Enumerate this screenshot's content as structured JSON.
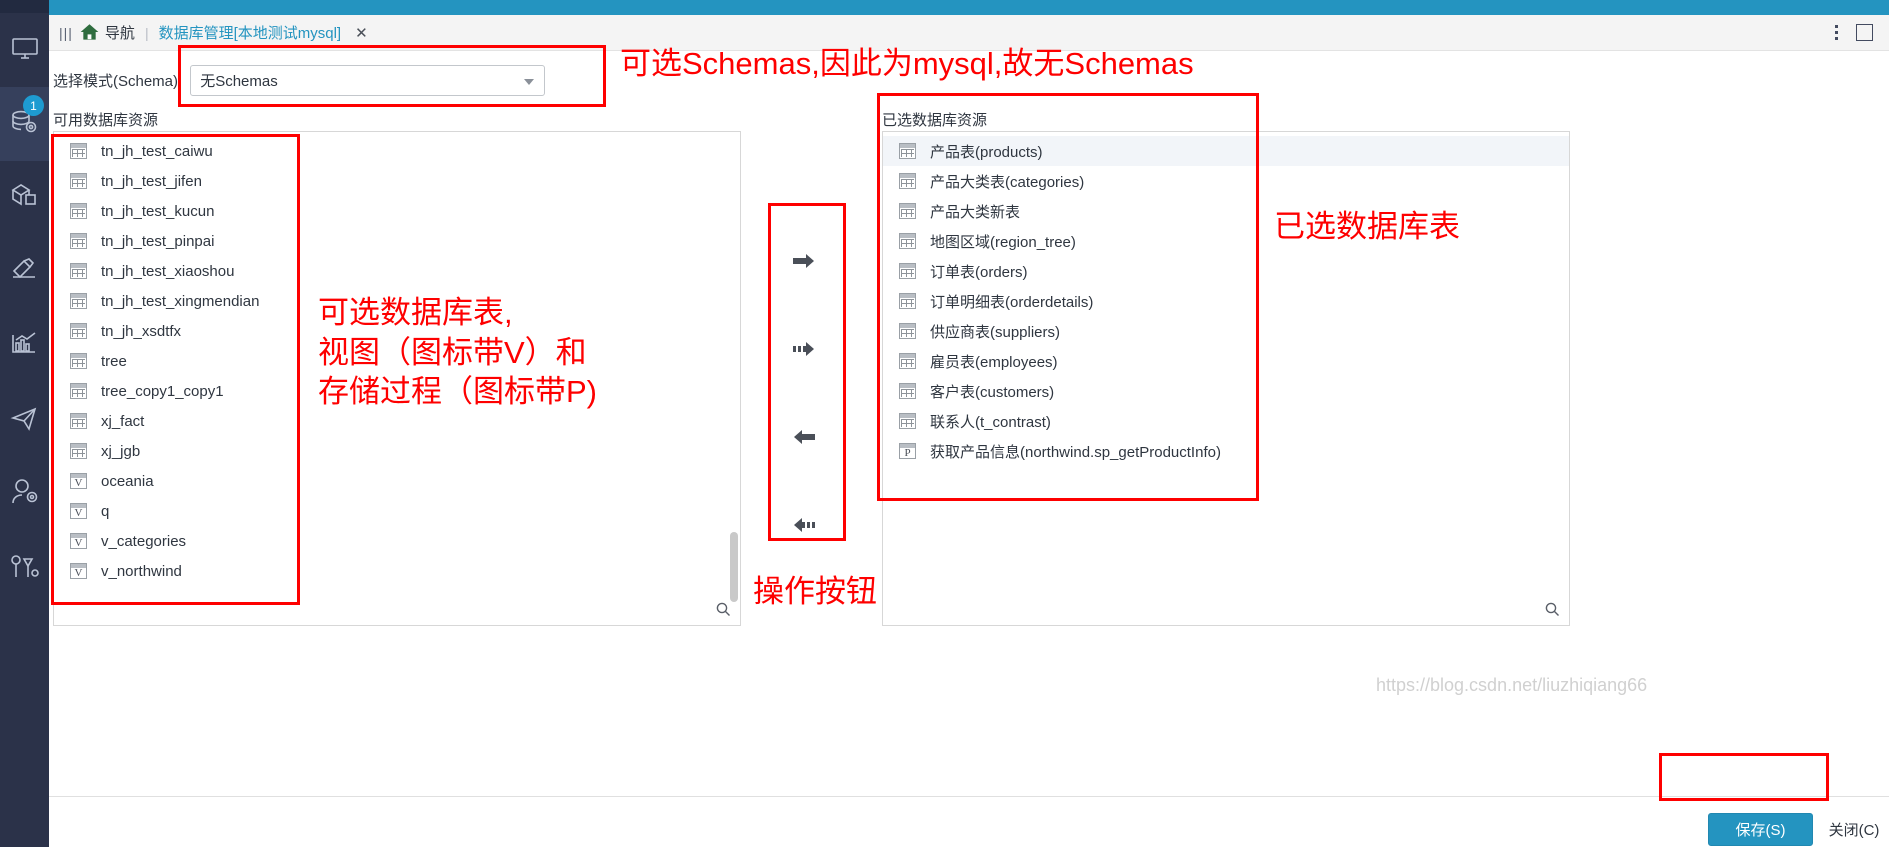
{
  "window": {
    "topbar_color": "#2494c0",
    "accent_color": "#2494c0",
    "annotation_color": "#fe0000"
  },
  "tabstrip": {
    "grip_icon": "grip-icon",
    "home_icon": "home-icon",
    "nav_label": "导航",
    "separator": "|",
    "tab_title": "数据库管理[本地测试mysql]",
    "tab_close": "✕",
    "kebab_icon": "more-options-icon",
    "maximize_icon": "maximize-icon"
  },
  "sidebar": {
    "items": [
      {
        "icon": "monitor-icon",
        "active": false,
        "badge": null
      },
      {
        "icon": "database-settings-icon",
        "active": true,
        "badge": "1"
      },
      {
        "icon": "package-icon",
        "active": false,
        "badge": null
      },
      {
        "icon": "hammer-icon",
        "active": false,
        "badge": null
      },
      {
        "icon": "bar-chart-icon",
        "active": false,
        "badge": null
      },
      {
        "icon": "send-icon",
        "active": false,
        "badge": null
      },
      {
        "icon": "user-settings-icon",
        "active": false,
        "badge": null
      },
      {
        "icon": "tools-icon",
        "active": false,
        "badge": null
      }
    ]
  },
  "schema": {
    "label": "选择模式(Schema):",
    "value": "无Schemas",
    "dropdown_icon": "chevron-down-icon"
  },
  "available": {
    "title": "可用数据库资源",
    "search_icon": "search-icon",
    "items": [
      {
        "name": "tn_jh_test_caiwu",
        "kind": "table"
      },
      {
        "name": "tn_jh_test_jifen",
        "kind": "table"
      },
      {
        "name": "tn_jh_test_kucun",
        "kind": "table"
      },
      {
        "name": "tn_jh_test_pinpai",
        "kind": "table"
      },
      {
        "name": "tn_jh_test_xiaoshou",
        "kind": "table"
      },
      {
        "name": "tn_jh_test_xingmendian",
        "kind": "table"
      },
      {
        "name": "tn_jh_xsdtfx",
        "kind": "table"
      },
      {
        "name": "tree",
        "kind": "table"
      },
      {
        "name": "tree_copy1_copy1",
        "kind": "table"
      },
      {
        "name": "xj_fact",
        "kind": "table"
      },
      {
        "name": "xj_jgb",
        "kind": "table"
      },
      {
        "name": "oceania",
        "kind": "view"
      },
      {
        "name": "q",
        "kind": "view"
      },
      {
        "name": "v_categories",
        "kind": "view"
      },
      {
        "name": "v_northwind",
        "kind": "view"
      }
    ]
  },
  "selected": {
    "title": "已选数据库资源",
    "search_icon": "search-icon",
    "items": [
      {
        "name": "产品表(products)",
        "kind": "table",
        "selected": true
      },
      {
        "name": "产品大类表(categories)",
        "kind": "table",
        "selected": false
      },
      {
        "name": "产品大类新表",
        "kind": "table",
        "selected": false
      },
      {
        "name": "地图区域(region_tree)",
        "kind": "table",
        "selected": false
      },
      {
        "name": "订单表(orders)",
        "kind": "table",
        "selected": false
      },
      {
        "name": "订单明细表(orderdetails)",
        "kind": "table",
        "selected": false
      },
      {
        "name": "供应商表(suppliers)",
        "kind": "table",
        "selected": false
      },
      {
        "name": "雇员表(employees)",
        "kind": "table",
        "selected": false
      },
      {
        "name": "客户表(customers)",
        "kind": "table",
        "selected": false
      },
      {
        "name": "联系人(t_contrast)",
        "kind": "table",
        "selected": false
      },
      {
        "name": "获取产品信息(northwind.sp_getProductInfo)",
        "kind": "procedure",
        "selected": false
      }
    ]
  },
  "transfer": {
    "buttons": [
      {
        "icon": "arrow-right-icon",
        "name": "move-right-button"
      },
      {
        "icon": "arrow-right-all-icon",
        "name": "move-all-right-button"
      },
      {
        "icon": "arrow-left-icon",
        "name": "move-left-button"
      },
      {
        "icon": "arrow-left-all-icon",
        "name": "move-all-left-button"
      }
    ]
  },
  "footer": {
    "save_label": "保存(S)",
    "close_label": "关闭(C)"
  },
  "annotations": {
    "schema": "可选Schemas,因此为mysql,故无Schemas",
    "available": "可选数据库表,\n视图（图标带V）和\n存储过程（图标带P)",
    "transfer": "操作按钮",
    "selected": "已选数据库表"
  },
  "watermark": "https://blog.csdn.net/liuzhiqiang66"
}
